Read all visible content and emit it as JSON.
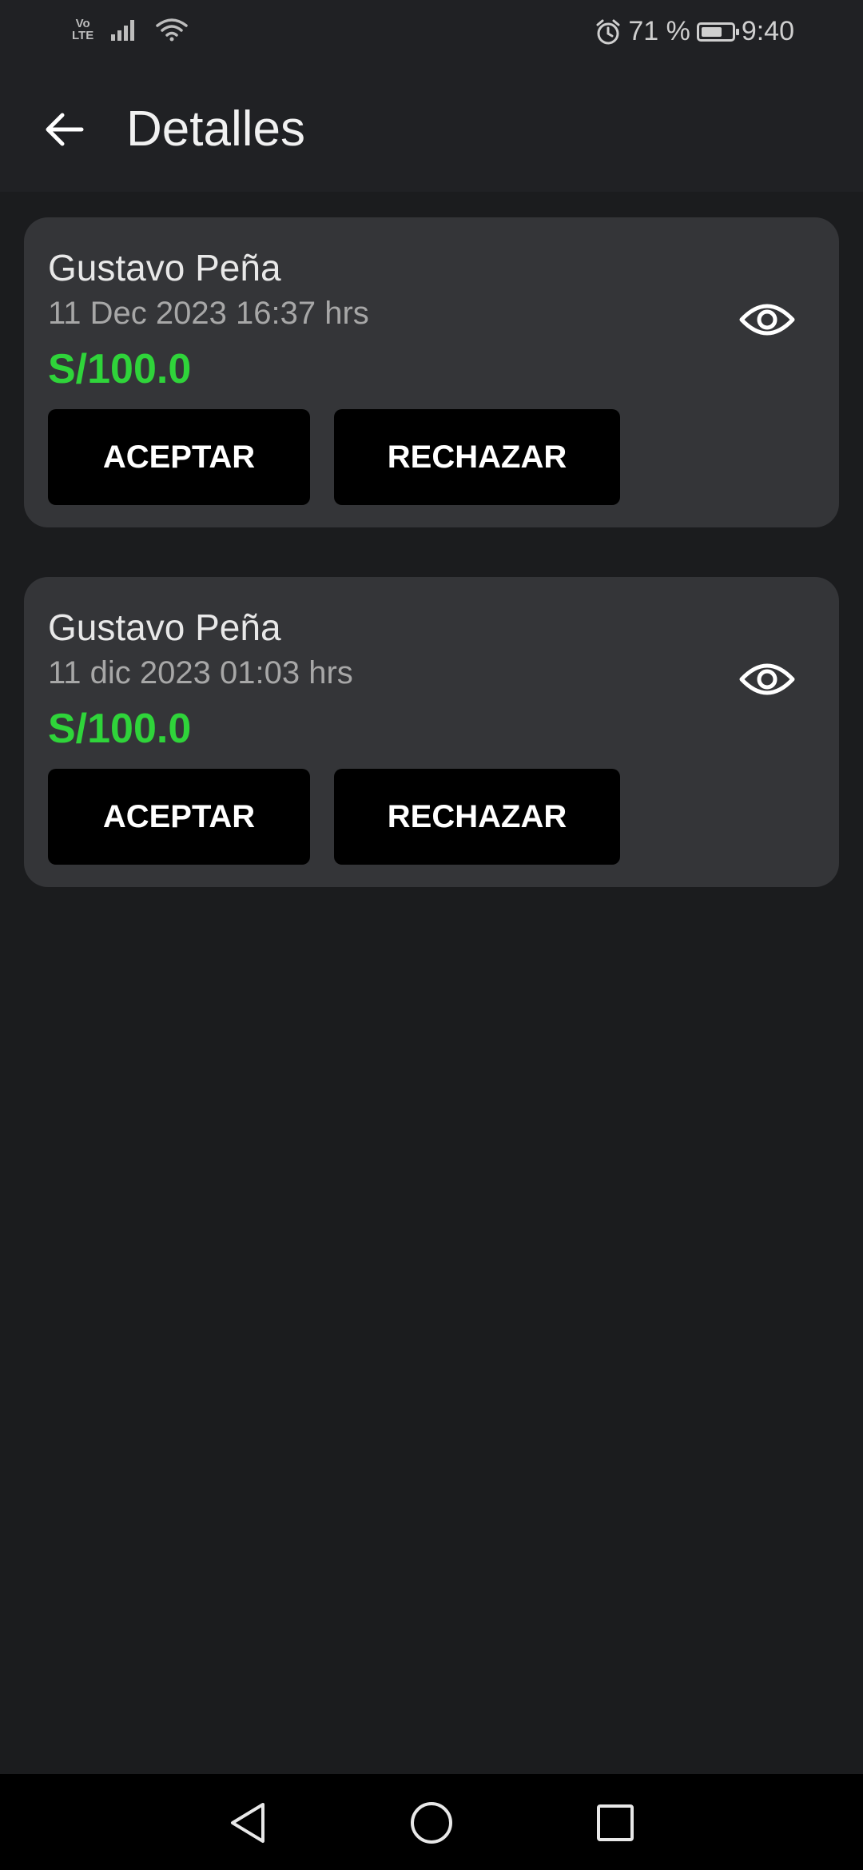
{
  "status_bar": {
    "volte_top": "Vo",
    "volte_bottom": "LTE",
    "battery_text": "71 %",
    "battery_level": 0.71,
    "time": "9:40",
    "icons": [
      "signal-icon",
      "wifi-icon",
      "alarm-icon",
      "battery-icon"
    ]
  },
  "header": {
    "title": "Detalles",
    "back_icon": "arrow-left-icon"
  },
  "cards": [
    {
      "name": "Gustavo Peña",
      "date": "11 Dec 2023 16:37 hrs",
      "amount": "S/100.0",
      "accept_label": "ACEPTAR",
      "reject_label": "RECHAZAR",
      "view_icon": "eye-icon"
    },
    {
      "name": "Gustavo Peña",
      "date": "11 dic 2023 01:03 hrs",
      "amount": "S/100.0",
      "accept_label": "ACEPTAR",
      "reject_label": "RECHAZAR",
      "view_icon": "eye-icon"
    }
  ],
  "nav_bar": {
    "icons": [
      "back-triangle-icon",
      "home-circle-icon",
      "recents-square-icon"
    ]
  },
  "colors": {
    "background": "#1b1c1e",
    "card": "#343538",
    "amount": "#2fd43a",
    "button": "#000000"
  }
}
